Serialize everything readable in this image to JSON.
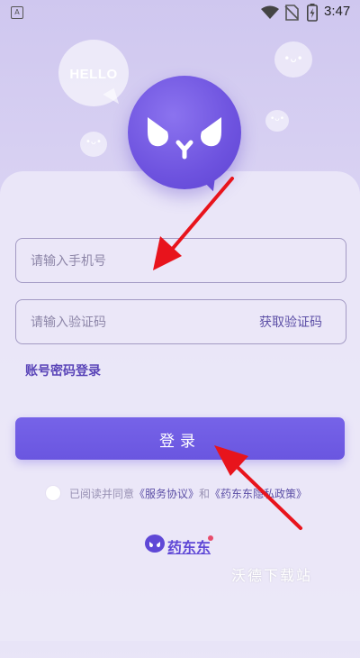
{
  "status_bar": {
    "notification_icon": "A",
    "time": "3:47",
    "icons": [
      "wifi-icon",
      "no-sim-icon",
      "battery-charging-icon"
    ]
  },
  "decorations": {
    "hello_bubble": "HELLO",
    "bubble_faces": [
      "•ᴗ•",
      "•ᴗ•",
      "•ᴗ•"
    ],
    "logo": "ᑐᵧᑐ"
  },
  "form": {
    "phone_placeholder": "请输入手机号",
    "code_placeholder": "请输入验证码",
    "get_code_label": "获取验证码",
    "password_login_label": "账号密码登录",
    "login_button_label": "登录"
  },
  "agreement": {
    "prefix": "已阅读并同意",
    "service_link": "《服务协议》",
    "conjunction": "和",
    "privacy_link": "《药东东隐私政策》"
  },
  "brand": {
    "name": "药东东"
  },
  "watermark": "沃德下载站",
  "colors": {
    "accent": "#6a56e0",
    "link": "#5c4fa6",
    "annotation_arrow": "#e8141c"
  }
}
